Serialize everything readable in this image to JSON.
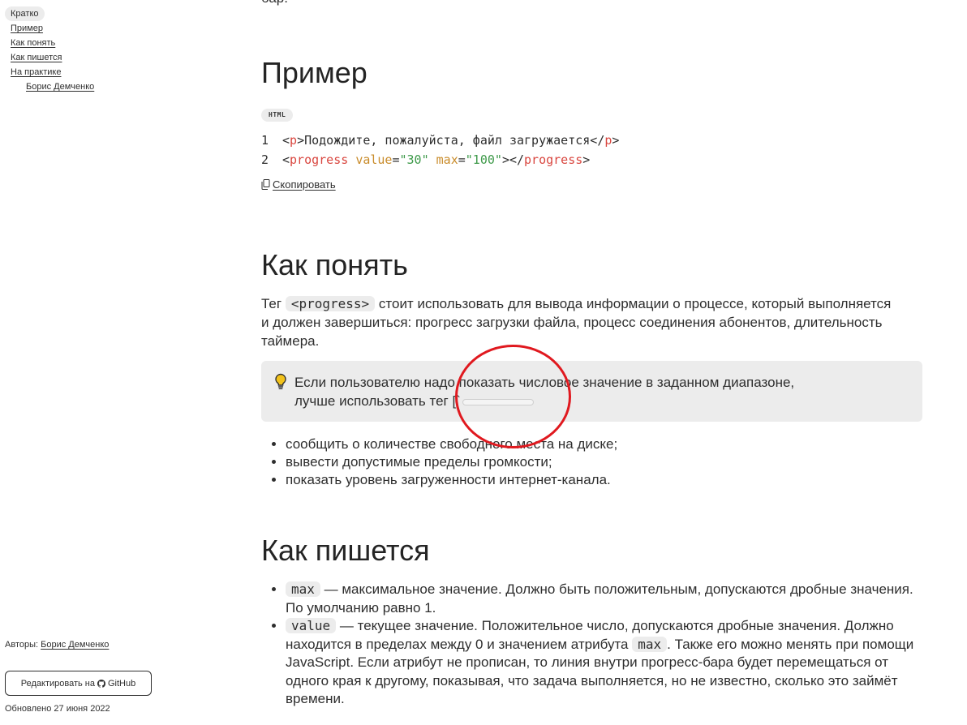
{
  "sidebar": {
    "toc": [
      {
        "label": "Кратко",
        "active": true
      },
      {
        "label": "Пример"
      },
      {
        "label": "Как понять"
      },
      {
        "label": "Как пишется"
      },
      {
        "label": "На практике"
      },
      {
        "label": "Борис Демченко"
      }
    ],
    "authors_label": "Авторы:",
    "author_name": "Борис Демченко",
    "edit_button_label": "Редактировать на",
    "edit_button_brand": "GitHub",
    "updated": "Обновлено 27 июня 2022"
  },
  "main": {
    "top_fragment": "бар.",
    "example": {
      "heading": "Пример",
      "lang_badge": "HTML",
      "code_lines": [
        {
          "num": "1",
          "open_tag": "p",
          "text": "Подождите, пожалуйста, файл загружается",
          "close_tag": "p"
        },
        {
          "num": "2",
          "tag": "progress",
          "attr1": "value",
          "val1": "\"30\"",
          "attr2": "max",
          "val2": "\"100\"",
          "close_tag": "progress"
        }
      ],
      "copy_label": "Скопировать"
    },
    "understand": {
      "heading": "Как понять",
      "para_before": "Тег",
      "para_code": "<progress>",
      "para_after": "стоит использовать для вывода информации о процессе, который выполняется и должен завершиться: прогресс загрузки файла, процесс соединения абонентов, длительность таймера.",
      "callout_line1": "Если пользователю надо показать числовое значение в заданном диапазоне,",
      "callout_line2": "лучше использовать тег [`",
      "callout_icon": "lightbulb-icon",
      "use_cases": [
        "сообщить о количестве свободного места на диске;",
        "вывести допустимые пределы громкости;",
        "показать уровень загруженности интернет-канала."
      ]
    },
    "syntax": {
      "heading": "Как пишется",
      "items": [
        {
          "code": "max",
          "text": "— максимальное значение. Должно быть положительным, допускаются дробные значения. По умолчанию равно 1."
        },
        {
          "code": "value",
          "text_before": "— текущее значение. Положительное число, допускаются дробные значения. Должно находится в пределах между 0 и значением атрибута",
          "inline_code": "max",
          "text_after": ". Также его можно менять при помощи JavaScript. Если атрибут не прописан, то линия внутри прогресс-бара будет перемещаться от одного края к другому, показывая, что задача выполняется, но не известно, сколько это займёт времени."
        }
      ]
    }
  },
  "annotation": {
    "color": "#e0191f",
    "shape": "circle"
  }
}
